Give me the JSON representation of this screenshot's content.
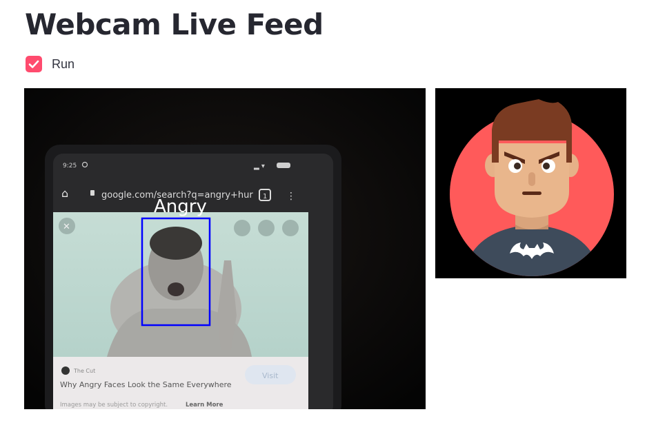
{
  "page": {
    "title": "Webcam Live Feed"
  },
  "run_checkbox": {
    "label": "Run",
    "checked": true,
    "accent": "#ff4b6e"
  },
  "webcam": {
    "detected_emotion": "Angry",
    "box_color": "#0000ff",
    "phone": {
      "status_time": "9:25",
      "url": "google.com/search?q=angry+hur",
      "tab_count": "1",
      "source_name": "The Cut",
      "result_title": "Why Angry Faces Look the Same Everywhere",
      "visit_label": "Visit",
      "copyright_note": "Images may be subject to copyright.",
      "learn_more": "Learn More"
    }
  },
  "emoji": {
    "name": "angry-avatar",
    "background": "#ff5a5a"
  }
}
